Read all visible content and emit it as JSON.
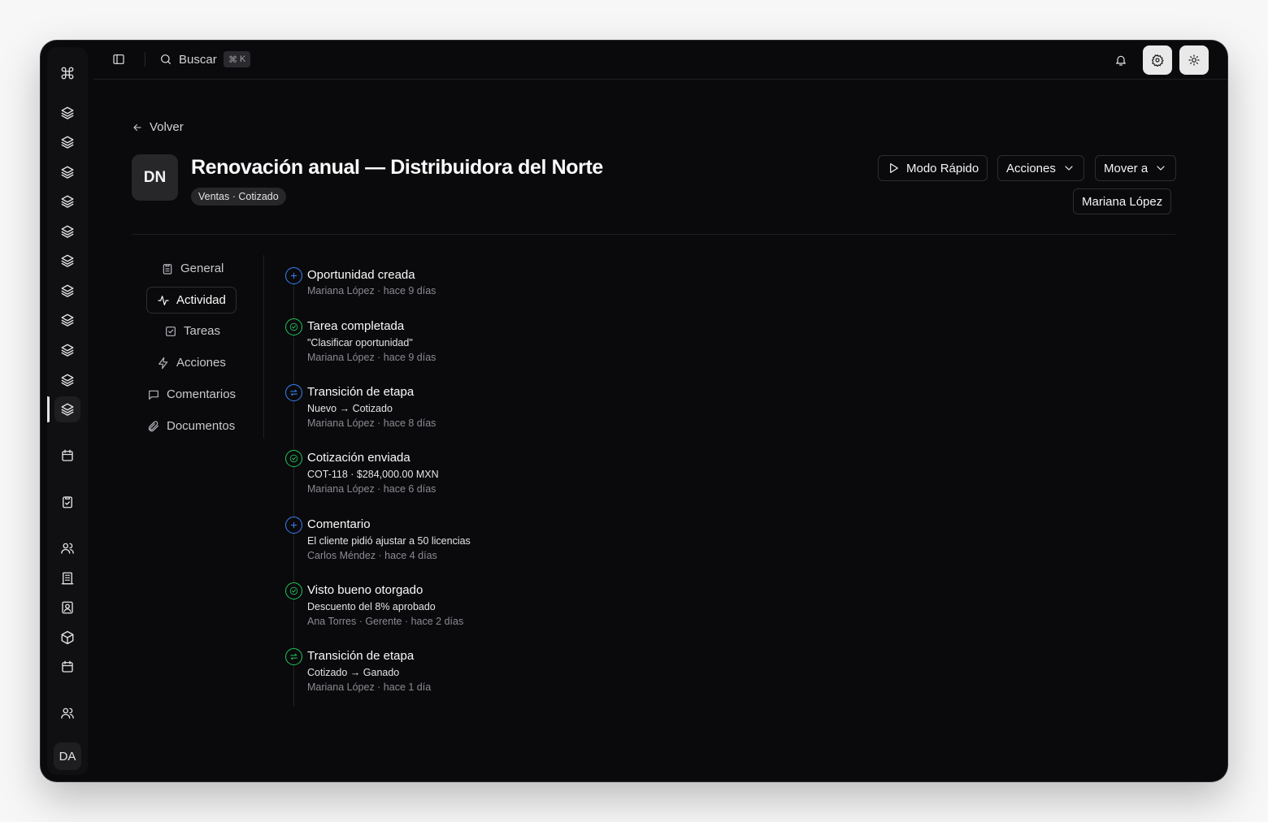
{
  "rail": {
    "logo_icon": "command-icon",
    "layers_count": 11,
    "bottom_icons": [
      "calendar-icon",
      "clipboard-icon",
      "users-icon",
      "building-icon",
      "contact-icon",
      "box-icon",
      "calendar-icon",
      "users-icon"
    ],
    "avatar": "DA"
  },
  "topbar": {
    "search_label": "Buscar",
    "shortcut_symbol": "⌘",
    "shortcut_key": "K"
  },
  "header": {
    "back_label": "Volver",
    "initials": "DN",
    "title": "Renovación anual — Distribuidora del Norte",
    "badge": "Ventas · Cotizado",
    "quick_mode_label": "Modo Rápido",
    "actions_label": "Acciones",
    "move_label": "Mover a",
    "owner_label": "Mariana López"
  },
  "tabs": [
    {
      "label": "General",
      "icon": "clipboard-icon"
    },
    {
      "label": "Actividad",
      "icon": "activity-icon",
      "active": true
    },
    {
      "label": "Tareas",
      "icon": "check-square-icon"
    },
    {
      "label": "Acciones",
      "icon": "zap-icon"
    },
    {
      "label": "Comentarios",
      "icon": "message-square-icon"
    },
    {
      "label": "Documentos",
      "icon": "paperclip-icon"
    }
  ],
  "timeline": [
    {
      "title": "Oportunidad creada",
      "detail": "",
      "meta": "Mariana López · hace 9 días",
      "icon": "plus-icon",
      "color": "#3b82f6"
    },
    {
      "title": "Tarea completada",
      "detail": "\"Clasificar oportunidad\"",
      "meta": "Mariana López · hace 9 días",
      "icon": "check-icon",
      "color": "#22c55e"
    },
    {
      "title": "Transición de etapa",
      "detail": "Nuevo → Cotizado",
      "meta": "Mariana López · hace 8 días",
      "icon": "arrows-icon",
      "color": "#3b82f6"
    },
    {
      "title": "Cotización enviada",
      "detail": "COT-118 · $284,000.00 MXN",
      "meta": "Mariana López · hace 6 días",
      "icon": "check-icon",
      "color": "#22c55e"
    },
    {
      "title": "Comentario",
      "detail": "El cliente pidió ajustar a 50 licencias",
      "meta": "Carlos Méndez · hace 4 días",
      "icon": "plus-icon",
      "color": "#3b82f6"
    },
    {
      "title": "Visto bueno otorgado",
      "detail": "Descuento del 8% aprobado",
      "meta": "Ana Torres · Gerente · hace 2 días",
      "icon": "check-icon",
      "color": "#22c55e"
    },
    {
      "title": "Transición de etapa",
      "detail": "Cotizado → Ganado",
      "meta": "Mariana López · hace 1 día",
      "icon": "arrows-icon",
      "color": "#22c55e"
    }
  ]
}
